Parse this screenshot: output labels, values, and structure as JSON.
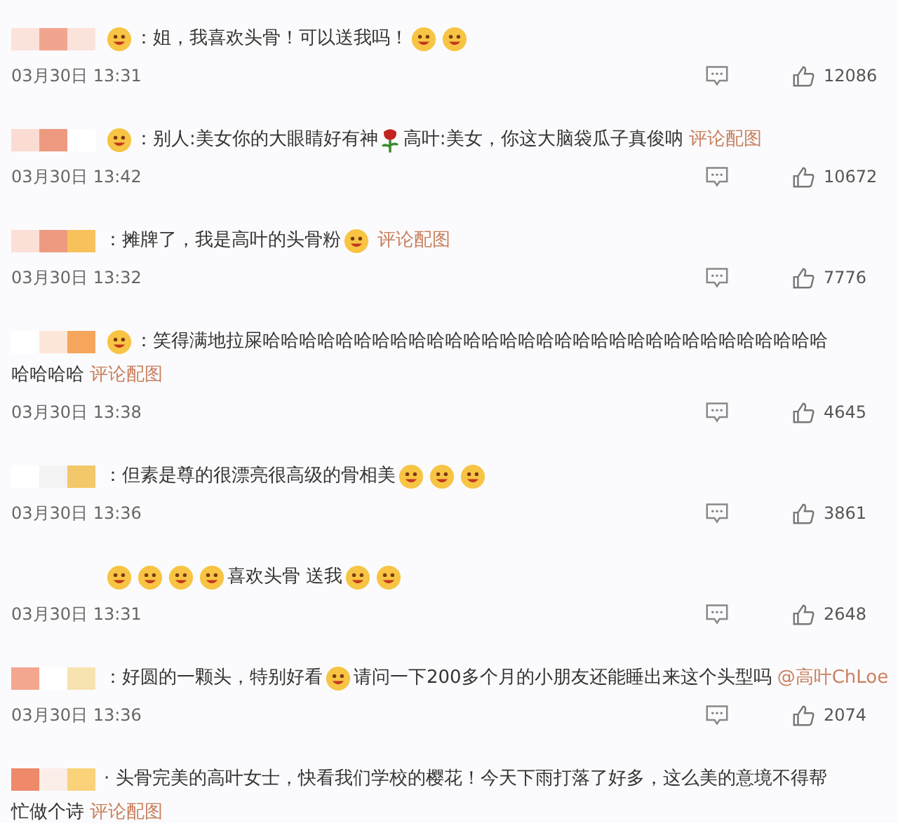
{
  "comments": [
    {
      "name_masked": true,
      "lines": [
        [
          {
            "kind": "emoji"
          },
          {
            "kind": "text",
            "text": "：姐，我喜欢头骨！可以送我吗！"
          },
          {
            "kind": "emoji"
          },
          {
            "kind": "emoji"
          }
        ]
      ],
      "time": "03月30日 13:31",
      "likes": "12086"
    },
    {
      "name_masked": true,
      "lines": [
        [
          {
            "kind": "emoji"
          },
          {
            "kind": "text",
            "text": "：别人:美女你的大眼睛好有神"
          },
          {
            "kind": "rose"
          },
          {
            "kind": "text",
            "text": " 高叶:美女，你这大脑袋瓜子真俊呐"
          },
          {
            "kind": "link",
            "text": "评论配图"
          }
        ]
      ],
      "time": "03月30日 13:42",
      "likes": "10672"
    },
    {
      "name_masked": true,
      "lines": [
        [
          {
            "kind": "text",
            "text": "：摊牌了，我是高叶的头骨粉"
          },
          {
            "kind": "emoji"
          },
          {
            "kind": "link",
            "text": "评论配图"
          }
        ]
      ],
      "time": "03月30日 13:32",
      "likes": "7776"
    },
    {
      "name_masked": true,
      "lines": [
        [
          {
            "kind": "emoji"
          },
          {
            "kind": "text",
            "text": "：笑得满地拉屎哈哈哈哈哈哈哈哈哈哈哈哈哈哈哈哈哈哈哈哈哈哈哈哈哈哈哈哈哈哈哈"
          }
        ],
        [
          {
            "kind": "text",
            "text": "哈哈哈哈"
          },
          {
            "kind": "link",
            "text": "评论配图"
          }
        ]
      ],
      "time": "03月30日 13:38",
      "likes": "4645"
    },
    {
      "name_masked": true,
      "lines": [
        [
          {
            "kind": "text",
            "text": "：但素是尊的很漂亮很高级的骨相美"
          },
          {
            "kind": "emoji"
          },
          {
            "kind": "emoji"
          },
          {
            "kind": "emoji"
          }
        ]
      ],
      "time": "03月30日 13:36",
      "likes": "3861"
    },
    {
      "name_masked": false,
      "lines": [
        [
          {
            "kind": "emoji"
          },
          {
            "kind": "emoji"
          },
          {
            "kind": "emoji"
          },
          {
            "kind": "emoji"
          },
          {
            "kind": "text",
            "text": "喜欢头骨 送我"
          },
          {
            "kind": "emoji"
          },
          {
            "kind": "emoji"
          }
        ]
      ],
      "time": "03月30日 13:31",
      "likes": "2648"
    },
    {
      "name_masked": true,
      "lines": [
        [
          {
            "kind": "text",
            "text": "：好圆的一颗头，特别好看"
          },
          {
            "kind": "emoji"
          },
          {
            "kind": "text",
            "text": "请问一下200多个月的小朋友还能睡出来这个头型吗"
          },
          {
            "kind": "link",
            "text": "@高叶ChLoe"
          }
        ]
      ],
      "time": "03月30日 13:36",
      "likes": "2074"
    },
    {
      "name_masked": true,
      "lines": [
        [
          {
            "kind": "text",
            "text": "· 头骨完美的高叶女士，快看我们学校的樱花！今天下雨打落了好多，这么美的意境不得帮"
          }
        ],
        [
          {
            "kind": "text",
            "text": "忙做个诗"
          },
          {
            "kind": "link",
            "text": "评论配图"
          }
        ]
      ]
    }
  ]
}
